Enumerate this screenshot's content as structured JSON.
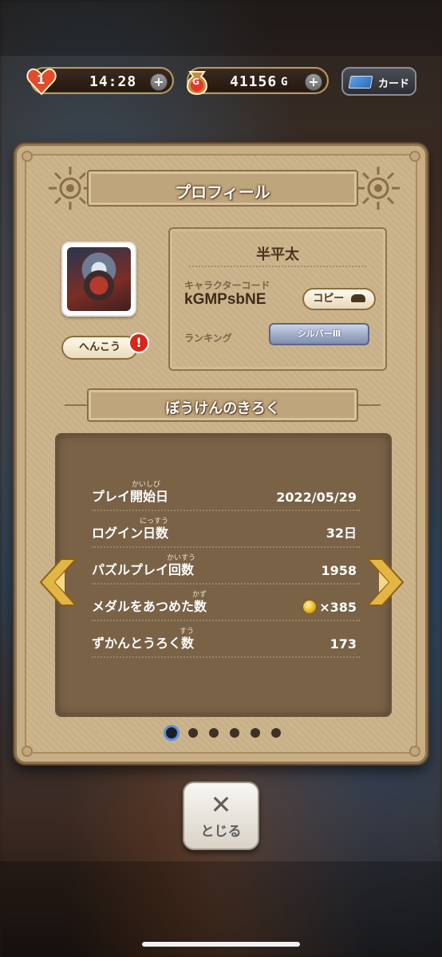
{
  "topbar": {
    "hearts": {
      "count": "1",
      "timer": "14:28"
    },
    "gold": {
      "icon_label": "G",
      "amount": "41156",
      "unit": "G"
    },
    "card_label": "カード"
  },
  "profile": {
    "title": "プロフィール",
    "change_label": "へんこう",
    "alert_mark": "!",
    "player_name": "半平太",
    "char_code_label": "キャラクターコード",
    "char_code": "kGMPsbNE",
    "copy_label": "コピー",
    "ranking_label": "ランキング",
    "rank": "シルバーⅢ"
  },
  "records": {
    "title": "ぼうけんのきろく",
    "rows": [
      {
        "label": "プレイ開始日",
        "ruby": "かいしび",
        "value": "2022/05/29"
      },
      {
        "label": "ログイン日数",
        "ruby": "にっすう",
        "value": "32日"
      },
      {
        "label": "パズルプレイ回数",
        "ruby": "かいすう",
        "value": "1958"
      },
      {
        "label": "メダルをあつめた数",
        "ruby": "かず",
        "value": "×385"
      },
      {
        "label": "ずかんとうろく数",
        "ruby": "すう",
        "value": "173"
      }
    ],
    "page_current": 1,
    "page_total": 6
  },
  "close": {
    "icon": "✕",
    "label": "とじる"
  },
  "colors": {
    "accent_blue": "#5d8fe6",
    "panel": "#cbb38a",
    "records_bg": "#7a6247"
  }
}
